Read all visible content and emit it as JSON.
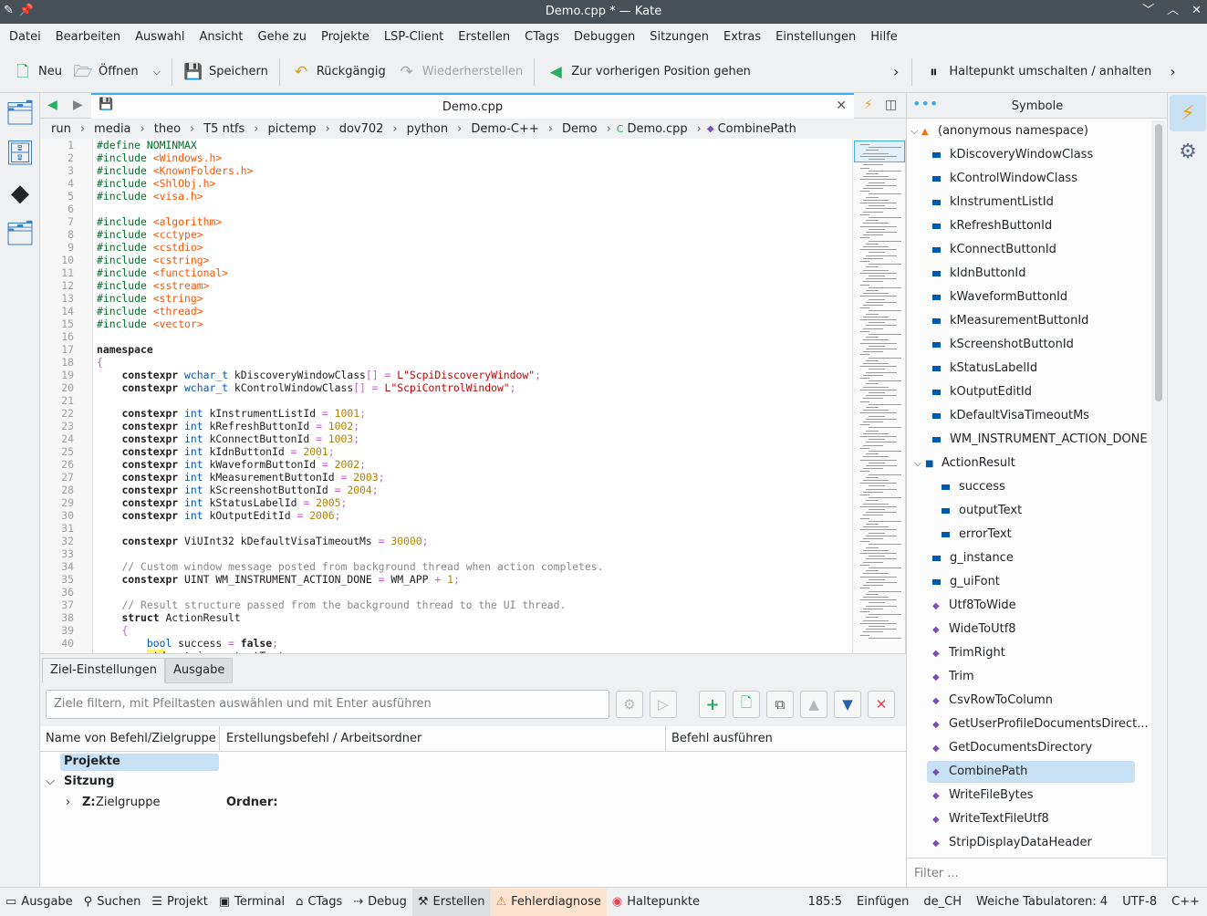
{
  "window": {
    "title": "Demo.cpp * — Kate"
  },
  "menu": [
    "Datei",
    "Bearbeiten",
    "Auswahl",
    "Ansicht",
    "Gehe zu",
    "Projekte",
    "LSP-Client",
    "Erstellen",
    "CTags",
    "Debuggen",
    "Sitzungen",
    "Extras",
    "Einstellungen",
    "Hilfe"
  ],
  "toolbar": {
    "new": "Neu",
    "open": "Öffnen",
    "save": "Speichern",
    "undo": "Rückgängig",
    "redo": "Wiederherstellen",
    "prev_pos": "Zur vorherigen Position gehen",
    "breakpoint": "Haltepunkt umschalten / anhalten"
  },
  "editor": {
    "tab": "Demo.cpp",
    "breadcrumb": [
      "run",
      "media",
      "theo",
      "T5 ntfs",
      "pictemp",
      "dov702",
      "python",
      "Demo-C++",
      "Demo",
      "Demo.cpp",
      "CombinePath"
    ],
    "line_numbers": [
      "1",
      "2",
      "3",
      "4",
      "5",
      "6",
      "7",
      "8",
      "9",
      "10",
      "11",
      "12",
      "13",
      "14",
      "15",
      "16",
      "17",
      "18",
      "19",
      "20",
      "21",
      "22",
      "23",
      "24",
      "25",
      "26",
      "27",
      "28",
      "29",
      "30",
      "31",
      "32",
      "33",
      "34",
      "35",
      "36",
      "37",
      "38",
      "39",
      "40"
    ]
  },
  "bottom": {
    "tabs": [
      "Ziel-Einstellungen",
      "Ausgabe"
    ],
    "filter_placeholder": "Ziele filtern, mit Pfeiltasten auswählen und mit Enter ausführen",
    "columns": [
      "Name von Befehl/Zielgruppe",
      "Erstellungsbefehl / Arbeitsordner",
      "Befehl ausführen"
    ],
    "rows": {
      "projekte": "Projekte",
      "sitzung": "Sitzung",
      "z_label": "Z:",
      "z_group": "Zielgruppe",
      "ordner": "Ordner:"
    }
  },
  "symbols": {
    "title": "Symbole",
    "namespace": "(anonymous namespace)",
    "items": [
      "kDiscoveryWindowClass",
      "kControlWindowClass",
      "kInstrumentListId",
      "kRefreshButtonId",
      "kConnectButtonId",
      "kIdnButtonId",
      "kWaveformButtonId",
      "kMeasurementButtonId",
      "kScreenshotButtonId",
      "kStatusLabelId",
      "kOutputEditId",
      "kDefaultVisaTimeoutMs",
      "WM_INSTRUMENT_ACTION_DONE"
    ],
    "struct": "ActionResult",
    "struct_members": [
      "success",
      "outputText",
      "errorText"
    ],
    "globals": [
      "g_instance",
      "g_uiFont"
    ],
    "functions": [
      "Utf8ToWide",
      "WideToUtf8",
      "TrimRight",
      "Trim",
      "CsvRowToColumn",
      "GetUserProfileDocumentsDirect...",
      "GetDocumentsDirectory",
      "CombinePath",
      "WriteFileBytes",
      "WriteTextFileUtf8",
      "StripDisplayDataHeader"
    ],
    "selected": "CombinePath",
    "filter_placeholder": "Filter ..."
  },
  "statusbar": {
    "left": [
      "Ausgabe",
      "Suchen",
      "Projekt",
      "Terminal",
      "CTags",
      "Debug",
      "Erstellen",
      "Fehlerdiagnose",
      "Haltepunkte"
    ],
    "position": "185:5",
    "mode": "Einfügen",
    "lang": "de_CH",
    "tabs": "Weiche Tabulatoren: 4",
    "encoding": "UTF-8",
    "syntax": "C++"
  },
  "colors": {
    "accent": "#3daee9",
    "selection": "#c7e0f4",
    "titlebar": "#475057"
  }
}
